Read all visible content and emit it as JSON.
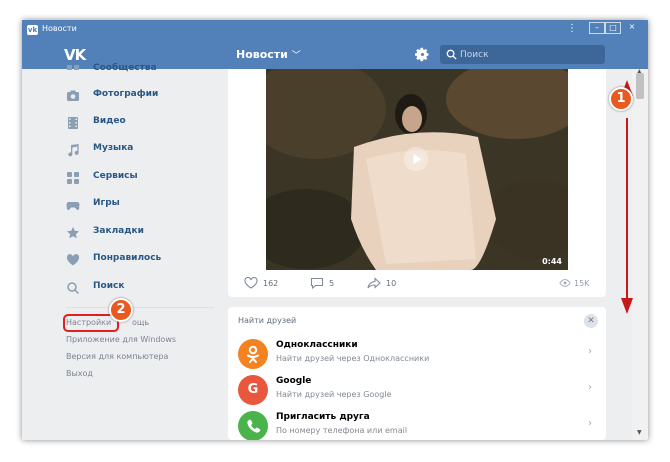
{
  "window": {
    "title": "Новости"
  },
  "header": {
    "section_title": "Новости",
    "search_placeholder": "Поиск"
  },
  "sidebar": {
    "items": [
      {
        "label": "Сообщества",
        "icon": "communities-icon"
      },
      {
        "label": "Фотографии",
        "icon": "camera-icon"
      },
      {
        "label": "Видео",
        "icon": "film-icon"
      },
      {
        "label": "Музыка",
        "icon": "music-note-icon"
      },
      {
        "label": "Сервисы",
        "icon": "services-grid-icon"
      },
      {
        "label": "Игры",
        "icon": "gamepad-icon"
      },
      {
        "label": "Закладки",
        "icon": "star-icon"
      },
      {
        "label": "Понравилось",
        "icon": "heart-icon"
      },
      {
        "label": "Поиск",
        "icon": "search-icon"
      }
    ],
    "settings": "Настройки",
    "settings_tail": "ощь",
    "app_windows": "Приложение для Windows",
    "desktop_version": "Версия для компьютера",
    "logout": "Выход"
  },
  "post": {
    "duration": "0:44",
    "likes": "162",
    "comments": "5",
    "shares": "10",
    "views": "15K"
  },
  "friends": {
    "title": "Найти друзей",
    "rows": [
      {
        "title": "Одноклассники",
        "subtitle": "Найти друзей через Одноклассники",
        "color": "#f58220",
        "glyph": "ok"
      },
      {
        "title": "Google",
        "subtitle": "Найти друзей через Google",
        "color": "#e9573f",
        "glyph": "G"
      },
      {
        "title": "Пригласить друга",
        "subtitle": "По номеру телефона или email",
        "color": "#4bb34b",
        "glyph": "phone"
      }
    ]
  },
  "annotations": {
    "badge1": "1",
    "badge2": "2"
  },
  "colors": {
    "brand": "#5181b8",
    "link": "#2a5885",
    "highlight": "#e02020",
    "badge": "#e85a1f"
  }
}
